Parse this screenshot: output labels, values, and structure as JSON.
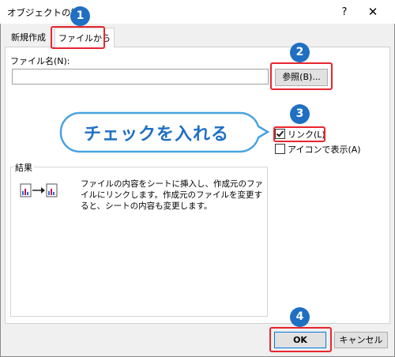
{
  "window": {
    "title": "オブジェクトの挿入",
    "help": "?",
    "close": "✕"
  },
  "tabs": [
    {
      "label": "新規作成",
      "active": false
    },
    {
      "label": "ファイルから",
      "active": true
    }
  ],
  "form": {
    "filename_label": "ファイル名(N):",
    "filename_value": "",
    "browse_label": "参照(B)...",
    "link_label": "リンク(L)",
    "link_checked": true,
    "icon_label": "アイコンで表示(A)",
    "icon_checked": false
  },
  "result": {
    "label": "結果",
    "text": "ファイルの内容をシートに挿入し、作成元のファイルにリンクします。作成元のファイルを変更すると、シートの内容も変更します。"
  },
  "buttons": {
    "ok": "OK",
    "cancel": "キャンセル"
  },
  "annotations": {
    "steps": [
      "1",
      "2",
      "3",
      "4"
    ],
    "callout": "チェックを入れる",
    "highlight_color": "#e8262f",
    "step_color": "#1f6fc3"
  }
}
